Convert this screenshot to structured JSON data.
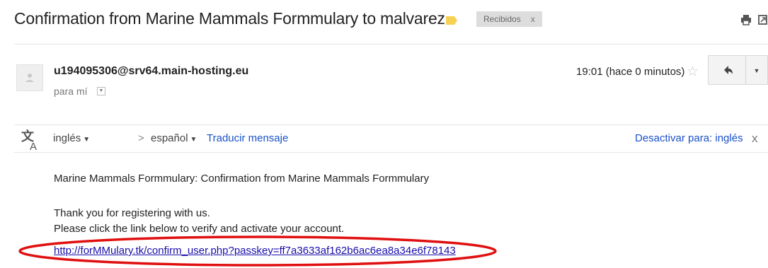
{
  "email": {
    "subject": "Confirmation from Marine Mammals Formmulary to malvarez",
    "label_chip": "Recibidos",
    "label_chip_close": "x",
    "label_color": "#f6d154",
    "sender": "u194095306@srv64.main-hosting.eu",
    "to_line": "para mí",
    "time": "19:01 (hace 0 minutos)",
    "icons": {
      "print": "print-icon",
      "new_window": "new-window-icon",
      "star": "star-icon",
      "reply": "reply-icon",
      "more": "chevron-down-icon",
      "translate": "translate-icon"
    }
  },
  "translate_bar": {
    "source_language": "inglés",
    "separator": ">",
    "target_language": "español",
    "translate_link": "Traducir mensaje",
    "deactivate_link": "Desactivar para: inglés",
    "close": "x"
  },
  "body": {
    "line1": "Marine Mammals Formmulary: Confirmation from Marine Mammals Formmulary",
    "line2": "Thank you for registering with us.",
    "line3": "Please click the link below to verify and activate your account.",
    "link": "http://forMMulary.tk/confirm_user.php?passkey=ff7a3633af162b6ac6ea8a34e6f78143"
  },
  "annotation": {
    "ellipse_color": "#e01010"
  }
}
